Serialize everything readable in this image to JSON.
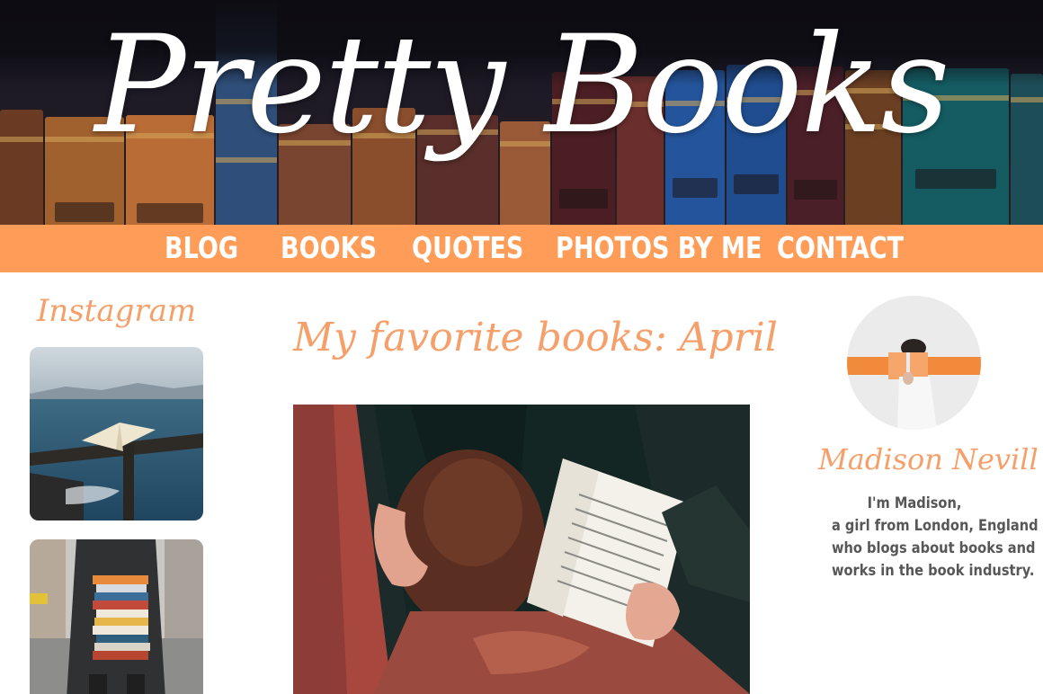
{
  "header": {
    "title": "Pretty Books"
  },
  "nav": {
    "items": [
      {
        "label": "BLOG"
      },
      {
        "label": "BOOKS"
      },
      {
        "label": "QUOTES"
      },
      {
        "label": "PHOTOS BY ME"
      },
      {
        "label": "CONTACT"
      }
    ]
  },
  "sidebar_left": {
    "title": "Instagram"
  },
  "post": {
    "title": "My favorite books: April"
  },
  "sidebar_right": {
    "name": "Madison Nevill",
    "bio": [
      "I'm Madison,",
      "a girl from London, England",
      "who blogs about books and",
      "works in the book industry."
    ]
  },
  "colors": {
    "accent": "#fe9c58",
    "title_text": "#f5a06a",
    "bio_text": "#575757",
    "nav_text": "#ffffff"
  }
}
